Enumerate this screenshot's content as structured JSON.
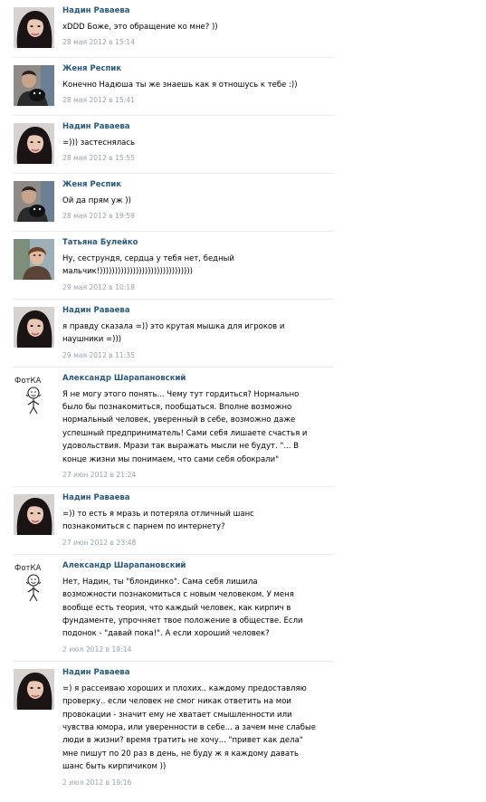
{
  "comments": [
    {
      "author": "Надин Раваева",
      "avatar": "girl-photo-icon",
      "lines": [
        "xDDD Боже, это обращение ко мне? ))"
      ],
      "date": "28 мая 2012 в 15:14"
    },
    {
      "author": "Женя Респик",
      "avatar": "man-with-dog-photo-icon",
      "lines": [
        "Конечно Надюша ты же знаешь как я отношусь к тебе :))"
      ],
      "date": "28 мая 2012 в 15:41"
    },
    {
      "author": "Надин Раваева",
      "avatar": "girl-photo-icon",
      "lines": [
        "=))) застеснялась"
      ],
      "date": "28 мая 2012 в 15:55"
    },
    {
      "author": "Женя Респик",
      "avatar": "man-with-dog-photo-icon",
      "lines": [
        "Ой да прям уж ))"
      ],
      "date": "28 мая 2012 в 19:59"
    },
    {
      "author": "Татьяна Булейко",
      "avatar": "woman-photo-icon",
      "lines": [
        "Ну, сеструндя, сердца у тебя нет, бедный",
        "мальчик!)))))))))))))))))))))))))))))))"
      ],
      "date": "29 мая 2012 в 10:18"
    },
    {
      "author": "Надин Раваева",
      "avatar": "girl-photo-icon",
      "lines": [
        "я правду сказала =)) это крутая мышка для игроков и",
        "наушники =)))"
      ],
      "date": "29 мая 2012 в 11:35"
    },
    {
      "author": "Александр Шарапановский",
      "avatar": "stick-figure-icon",
      "avatar_caption": "ФотКА",
      "lines": [
        "Я не могу этого понять... Чему тут гордиться? Нормально",
        "было бы познакомиться, пообщаться. Вполне возможно",
        "нормальный человек, уверенный в себе, возможно даже",
        "успешный предприниматель! Сами себя лишаете счастья и",
        "удовольствия. Мрази так выражать мысли не будут. \"... В",
        "конце жизни мы понимаем, что сами себя обокрали\""
      ],
      "date": "27 июн 2012 в 21:24"
    },
    {
      "author": "Надин Раваева",
      "avatar": "girl-photo-icon",
      "lines": [
        "=)) то есть я мразь и потеряла отличный шанс",
        "познакомиться с парнем по интернету?"
      ],
      "date": "27 июн 2012 в 23:48"
    },
    {
      "author": "Александр Шарапановский",
      "avatar": "stick-figure-icon",
      "avatar_caption": "ФотКА",
      "lines": [
        "Нет, Надин, ты \"блондинко\". Сама себя лишила",
        "возможности познакомиться с новым человеком. У меня",
        "вообще есть теория, что каждый человек, как кирпич в",
        "фундаменте, упрочняет твое положение в обществе. Если",
        "подонок - \"давай пока!\". А если хороший человек?"
      ],
      "date": "2 июл 2012 в 19:14"
    },
    {
      "author": "Надин Раваева",
      "avatar": "girl-photo-icon",
      "lines": [
        "=) я рассеиваю хороших и плохих.. каждому предоставляю",
        "проверку.. если человек не смог никак ответить на мои",
        "провокации - значит ему не хватает смышленности или",
        "чувства юмора, или уверенности в себе... а зачем мне слабые",
        "люди в жизни? время тратить не хочу... \"привет как дела\"",
        "мне пишут по 20 раз в день, не буду ж я каждому давать",
        "шанс быть кирпичиком ))"
      ],
      "date": "2 июл 2012 в 19:16"
    }
  ],
  "colors": {
    "author": "#2b587a",
    "date": "#9aa3ad",
    "text": "#000000",
    "separator": "#e9edf1"
  }
}
